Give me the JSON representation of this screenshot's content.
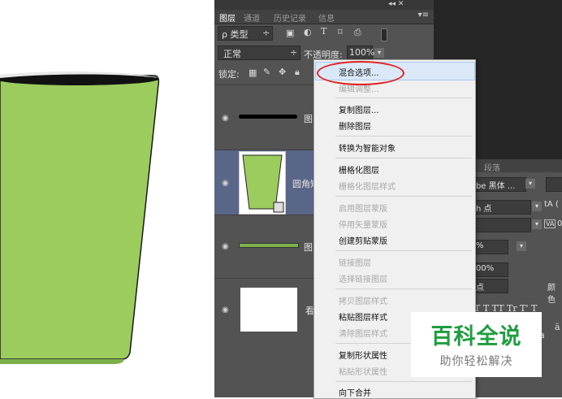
{
  "panel": {
    "controls": "◂◂  ✕",
    "tabs": [
      "图层",
      "通道",
      "历史记录",
      "信息"
    ],
    "tab_menu_icon": "▾≡",
    "filter_label": "ρ 类型",
    "filter_arrow": "÷",
    "blend_mode": "正常",
    "blend_arrow": "÷",
    "opacity_label": "不透明度:",
    "opacity_value": "100%",
    "lock_label": "锁定:"
  },
  "layers": [
    {
      "name": "图",
      "thumb": "black-stroke"
    },
    {
      "name": "圆角矩",
      "thumb": "green-cup",
      "selected": true
    },
    {
      "name": "图",
      "thumb": "green-stroke"
    },
    {
      "name": "看",
      "thumb": "white"
    }
  ],
  "context_menu": {
    "groups": [
      [
        {
          "label": "混合选项...",
          "enabled": true,
          "highlighted": true
        },
        {
          "label": "编辑调整...",
          "enabled": false
        }
      ],
      [
        {
          "label": "复制图层...",
          "enabled": true
        },
        {
          "label": "删除图层",
          "enabled": true
        }
      ],
      [
        {
          "label": "转换为智能对象",
          "enabled": true
        }
      ],
      [
        {
          "label": "栅格化图层",
          "enabled": true
        },
        {
          "label": "栅格化图层样式",
          "enabled": false
        }
      ],
      [
        {
          "label": "启用图层蒙版",
          "enabled": false
        },
        {
          "label": "停用矢量蒙版",
          "enabled": false
        },
        {
          "label": "创建剪贴蒙版",
          "enabled": true
        }
      ],
      [
        {
          "label": "链接图层",
          "enabled": false
        },
        {
          "label": "选择链接图层",
          "enabled": false
        }
      ],
      [
        {
          "label": "拷贝图层样式",
          "enabled": false
        },
        {
          "label": "粘贴图层样式",
          "enabled": true
        },
        {
          "label": "清除图层样式",
          "enabled": false
        }
      ],
      [
        {
          "label": "复制形状属性",
          "enabled": true
        },
        {
          "label": "粘贴形状属性",
          "enabled": false
        }
      ],
      [
        {
          "label": "向下合并",
          "enabled": true
        }
      ]
    ]
  },
  "char_panel": {
    "tab": "段落",
    "font_family": "be 黑体 ...",
    "font_size": "h 点",
    "tracking": "%",
    "scale": "00%",
    "baseline": "点",
    "color_label": "颜色",
    "metric_prefix": "(",
    "va_value": "0",
    "style_buttons": "T T TT Tr T' T",
    "aa_label": "a",
    "aa_icon": "ä"
  },
  "watermark": {
    "title": "百科全说",
    "subtitle": "助你轻松解决"
  },
  "colors": {
    "cup_green": "#9ccb5e",
    "panel_bg": "#535353",
    "menu_bg": "#f0f0f0",
    "highlight_oval": "#e02020",
    "watermark_green": "#1e9e3e"
  }
}
